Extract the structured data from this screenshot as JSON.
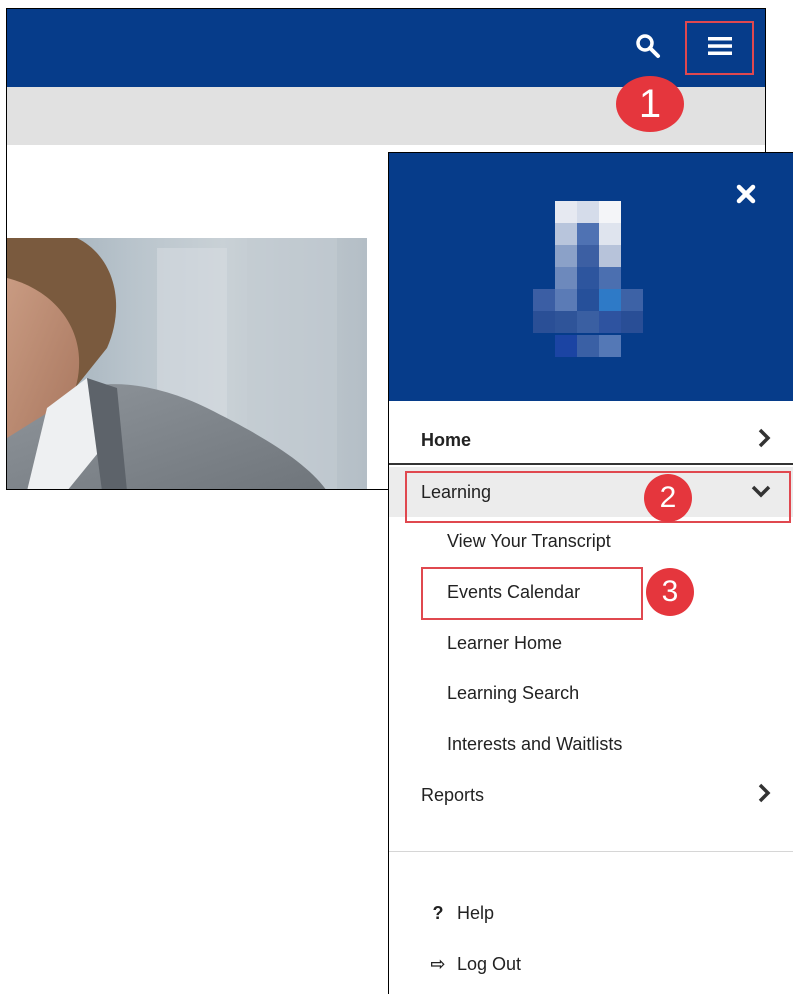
{
  "annotations": {
    "step1": "1",
    "step2": "2",
    "step3": "3"
  },
  "icons": {
    "search": "search-icon",
    "hamburger": "hamburger-menu-icon",
    "close": "close-icon",
    "chevron_right": "chevron-right-icon",
    "chevron_down": "chevron-down-icon",
    "help": "question-icon",
    "logout": "logout-icon"
  },
  "colors": {
    "brand_blue": "#063c8a",
    "highlight_red": "#e0484f",
    "badge_red": "#e5363d",
    "expanded_row_bg": "#ececec",
    "subbar_gray": "#e1e1e1"
  },
  "menu": {
    "home": {
      "label": "Home"
    },
    "learning": {
      "label": "Learning",
      "expanded": true,
      "items": [
        {
          "label": "View Your Transcript"
        },
        {
          "label": "Events Calendar"
        },
        {
          "label": "Learner Home"
        },
        {
          "label": "Learning Search"
        },
        {
          "label": "Interests and Waitlists"
        }
      ]
    },
    "reports": {
      "label": "Reports"
    },
    "footer": {
      "help": {
        "icon_glyph": "?",
        "label": "Help"
      },
      "logout": {
        "icon_glyph": "⇨",
        "label": "Log Out"
      }
    }
  }
}
